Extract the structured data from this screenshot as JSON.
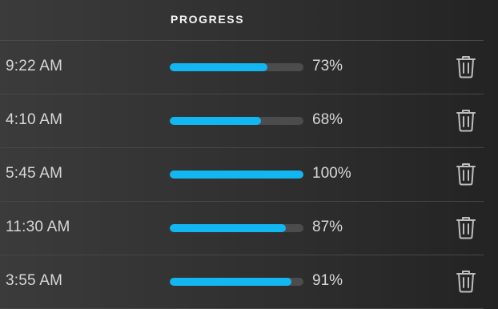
{
  "header": {
    "progress_label": "PROGRESS"
  },
  "colors": {
    "progress_fill": "#12b7f2",
    "progress_track": "#4c4c4c"
  },
  "rows": [
    {
      "time": "9:22 AM",
      "progress": 0.73,
      "percent_label": "73%",
      "action_icon": "trash-icon"
    },
    {
      "time": "4:10 AM",
      "progress": 0.68,
      "percent_label": "68%",
      "action_icon": "trash-icon"
    },
    {
      "time": "5:45 AM",
      "progress": 1.0,
      "percent_label": "100%",
      "action_icon": "trash-icon"
    },
    {
      "time": "11:30 AM",
      "progress": 0.87,
      "percent_label": "87%",
      "action_icon": "trash-icon"
    },
    {
      "time": "3:55 AM",
      "progress": 0.91,
      "percent_label": "91%",
      "action_icon": "trash-icon"
    }
  ]
}
